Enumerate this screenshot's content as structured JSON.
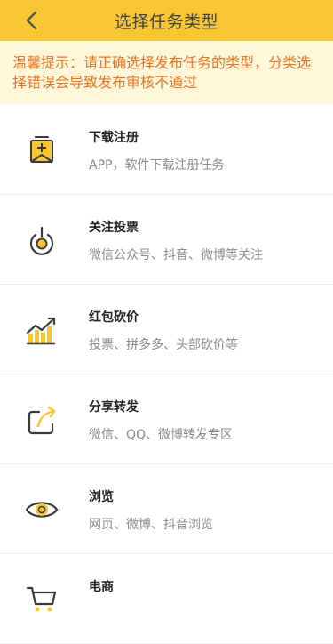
{
  "header": {
    "title": "选择任务类型",
    "back_icon": "chevron-left-icon",
    "background": "#f8c632"
  },
  "notice": {
    "text": "温馨提示：请正确选择发布任务的类型，分类选择错误会导致发布审核不通过",
    "color": "#f0741e",
    "background": "#fff7dc"
  },
  "categories": [
    {
      "title": "下载注册",
      "desc": "APP，软件下载注册任务",
      "icon": "download-register-icon"
    },
    {
      "title": "关注投票",
      "desc": "微信公众号、抖音、微博等关注",
      "icon": "follow-vote-icon"
    },
    {
      "title": "红包砍价",
      "desc": "投票、拼多多、头部砍价等",
      "icon": "bar-chart-trend-icon"
    },
    {
      "title": "分享转发",
      "desc": "微信、QQ、微博转发专区",
      "icon": "share-forward-icon"
    },
    {
      "title": "浏览",
      "desc": "网页、微博、抖音浏览",
      "icon": "eye-icon"
    },
    {
      "title": "电商",
      "desc": "",
      "icon": "ecommerce-icon"
    }
  ]
}
